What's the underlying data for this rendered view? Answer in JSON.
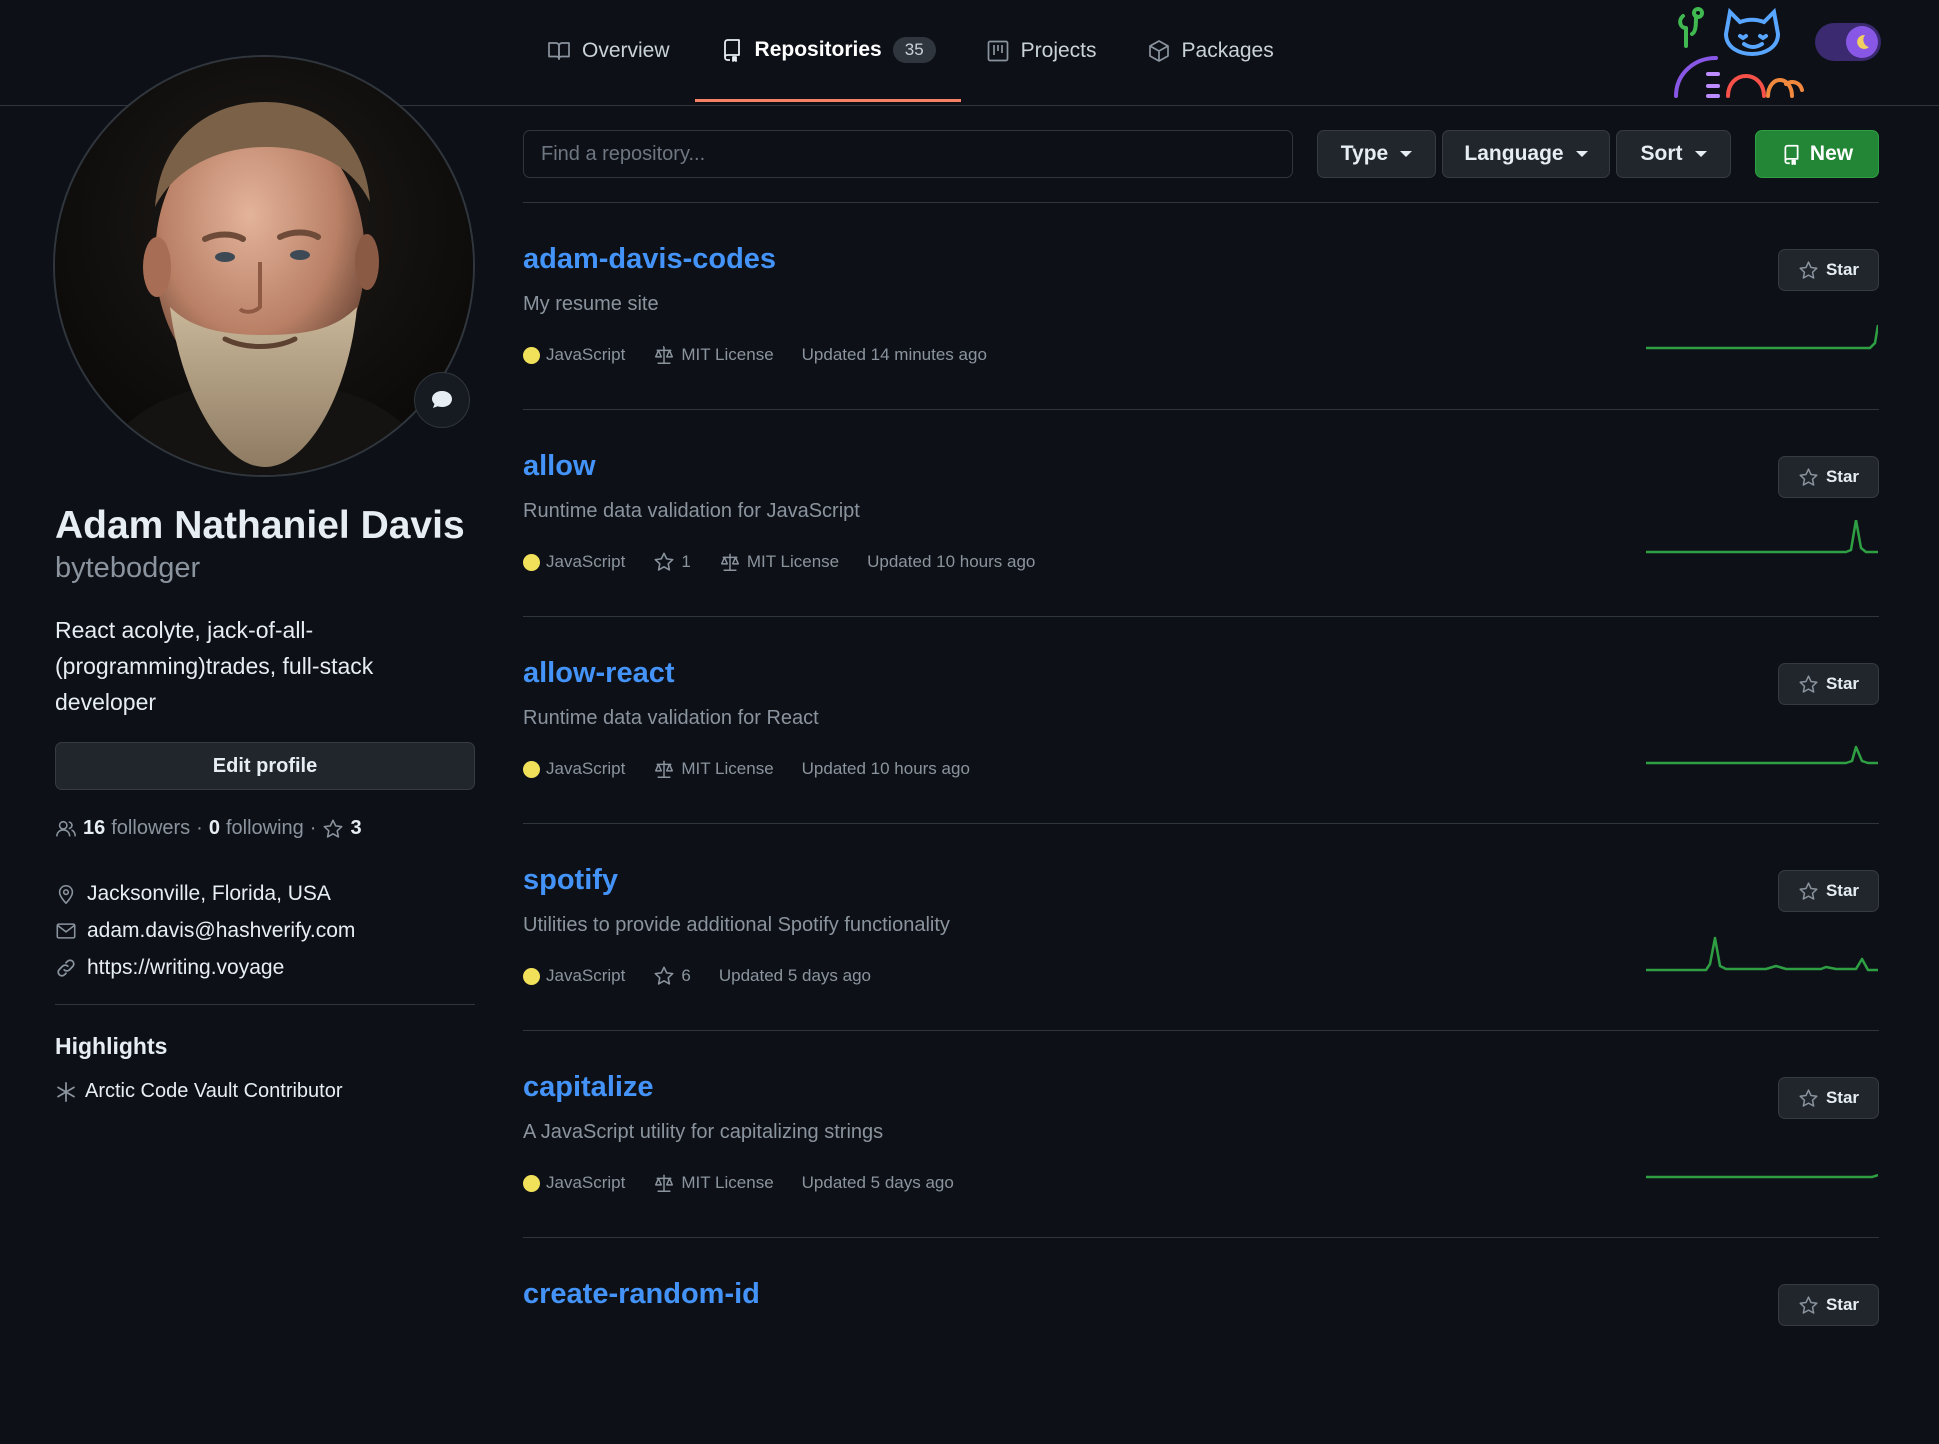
{
  "tabs": [
    {
      "label": "Overview",
      "icon": "book-icon"
    },
    {
      "label": "Repositories",
      "icon": "repo-icon",
      "count": "35",
      "active": true
    },
    {
      "label": "Projects",
      "icon": "project-icon"
    },
    {
      "label": "Packages",
      "icon": "package-icon"
    }
  ],
  "profile": {
    "full_name": "Adam Nathaniel Davis",
    "username": "bytebodger",
    "bio": "React acolyte, jack-of-all-(programming)trades, full-stack developer",
    "edit_label": "Edit profile",
    "followers_count": "16",
    "followers_label": "followers",
    "dot": "·",
    "following_count": "0",
    "following_label": "following",
    "stars_count": "3",
    "location": "Jacksonville, Florida, USA",
    "email": "adam.davis@hashverify.com",
    "website": "https://writing.voyage",
    "highlights_title": "Highlights",
    "highlight_item": "Arctic Code Vault Contributor"
  },
  "filters": {
    "search_placeholder": "Find a repository...",
    "type_label": "Type",
    "language_label": "Language",
    "sort_label": "Sort",
    "new_label": "New"
  },
  "repos": [
    {
      "name": "adam-davis-codes",
      "description": "My resume site",
      "language": "JavaScript",
      "stars": "",
      "license": "MIT License",
      "updated": "Updated 14 minutes ago",
      "star_label": "Star"
    },
    {
      "name": "allow",
      "description": "Runtime data validation for JavaScript",
      "language": "JavaScript",
      "stars": "1",
      "license": "MIT License",
      "updated": "Updated 10 hours ago",
      "star_label": "Star"
    },
    {
      "name": "allow-react",
      "description": "Runtime data validation for React",
      "language": "JavaScript",
      "stars": "",
      "license": "MIT License",
      "updated": "Updated 10 hours ago",
      "star_label": "Star"
    },
    {
      "name": "spotify",
      "description": "Utilities to provide additional Spotify functionality",
      "language": "JavaScript",
      "stars": "6",
      "license": "",
      "updated": "Updated 5 days ago",
      "star_label": "Star"
    },
    {
      "name": "capitalize",
      "description": "A JavaScript utility for capitalizing strings",
      "language": "JavaScript",
      "stars": "",
      "license": "MIT License",
      "updated": "Updated 5 days ago",
      "star_label": "Star"
    },
    {
      "name": "create-random-id",
      "description": "",
      "language": "",
      "stars": "",
      "license": "",
      "updated": "",
      "star_label": "Star"
    }
  ],
  "colors": {
    "link": "#4493f8",
    "accent_tab": "#f78166",
    "new_button": "#238636",
    "javascript": "#f1e05a",
    "spark": "#2ea043"
  }
}
